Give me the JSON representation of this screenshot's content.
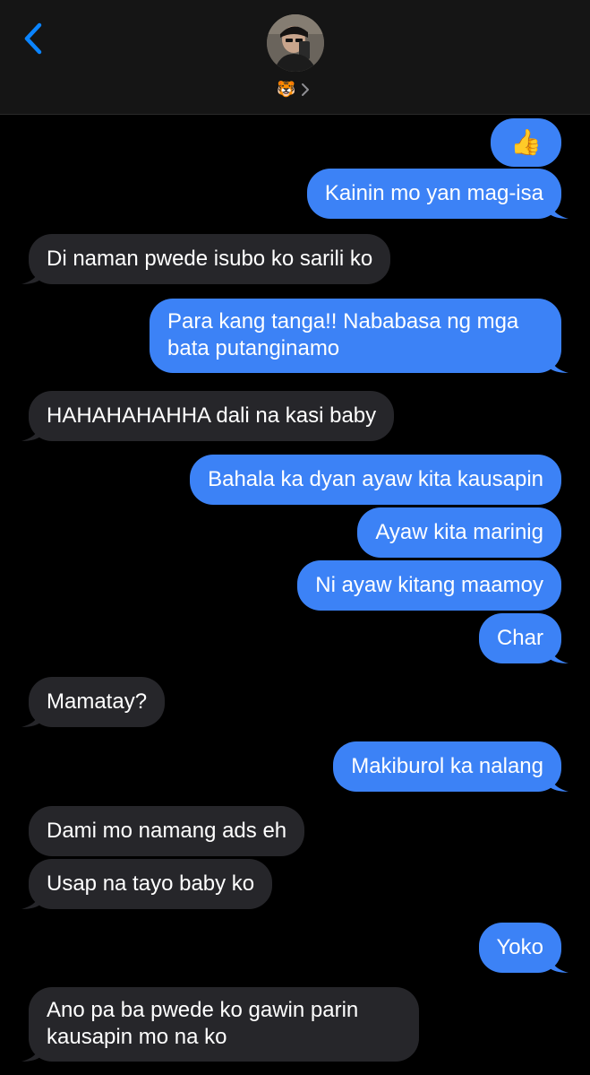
{
  "colors": {
    "background": "#000000",
    "header_bg": "#151515",
    "outgoing_bubble": "#3c82f6",
    "incoming_bubble": "#26262a",
    "accent": "#0a84ff",
    "text": "#ffffff"
  },
  "header": {
    "back_icon": "chevron-left-icon",
    "avatar_icon": "contact-avatar",
    "contact_emoji": "🐯",
    "details_icon": "chevron-right-icon"
  },
  "messages": [
    {
      "direction": "out",
      "text": "👍"
    },
    {
      "direction": "out",
      "text": "Kainin mo yan mag-isa"
    },
    {
      "direction": "in",
      "text": "Di naman pwede isubo ko sarili ko"
    },
    {
      "direction": "out",
      "text": "Para kang tanga!! Nababasa ng mga bata putanginamo"
    },
    {
      "direction": "in",
      "text": "HAHAHAHAHHA dali na kasi baby"
    },
    {
      "direction": "out",
      "text": "Bahala ka dyan ayaw kita kausapin"
    },
    {
      "direction": "out",
      "text": "Ayaw kita marinig"
    },
    {
      "direction": "out",
      "text": "Ni ayaw kitang maamoy"
    },
    {
      "direction": "out",
      "text": "Char"
    },
    {
      "direction": "in",
      "text": "Mamatay?"
    },
    {
      "direction": "out",
      "text": "Makiburol ka nalang"
    },
    {
      "direction": "in",
      "text": "Dami mo namang ads eh"
    },
    {
      "direction": "in",
      "text": "Usap na tayo baby ko"
    },
    {
      "direction": "out",
      "text": "Yoko"
    },
    {
      "direction": "in",
      "text": "Ano pa ba pwede ko gawin parin kausapin mo na ko"
    }
  ]
}
